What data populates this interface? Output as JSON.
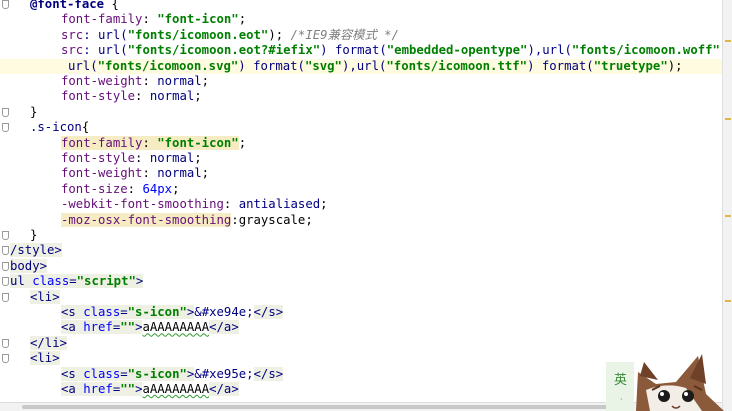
{
  "lines": [
    {
      "segs": [
        {
          "t": "@font-face",
          "c": "tok-kw"
        },
        {
          "t": " {",
          "c": "tok-punct"
        }
      ],
      "indent": 30,
      "fold": true
    },
    {
      "segs": [
        {
          "t": "font-family",
          "c": "tok-prop"
        },
        {
          "t": ": ",
          "c": "tok-punct"
        },
        {
          "t": "\"font-icon\"",
          "c": "tok-str"
        },
        {
          "t": ";",
          "c": "tok-punct"
        }
      ],
      "indent": 61
    },
    {
      "segs": [
        {
          "t": "src",
          "c": "tok-prop"
        },
        {
          "t": ": url(",
          "c": "tok-val"
        },
        {
          "t": "\"fonts/icomoon.eot\"",
          "c": "tok-str"
        },
        {
          "t": "); ",
          "c": "tok-punct"
        },
        {
          "t": "/*IE9兼容模式 */",
          "c": "tok-comment"
        }
      ],
      "indent": 61
    },
    {
      "segs": [
        {
          "t": "src",
          "c": "tok-prop"
        },
        {
          "t": ": url(",
          "c": "tok-val"
        },
        {
          "t": "\"fonts/icomoon.eot?#iefix\"",
          "c": "tok-str"
        },
        {
          "t": ") format(",
          "c": "tok-val"
        },
        {
          "t": "\"embedded-opentype\"",
          "c": "tok-str"
        },
        {
          "t": "),url(",
          "c": "tok-val"
        },
        {
          "t": "\"fonts/icomoon.woff\"",
          "c": "tok-str"
        },
        {
          "t": ")",
          "c": "tok-punct"
        }
      ],
      "indent": 61
    },
    {
      "segs": [
        {
          "t": "url(",
          "c": "tok-val"
        },
        {
          "t": "\"fonts/icomoon.svg\"",
          "c": "tok-str"
        },
        {
          "t": ") format(",
          "c": "tok-val"
        },
        {
          "t": "\"svg\"",
          "c": "tok-str"
        },
        {
          "t": "),url(",
          "c": "tok-val"
        },
        {
          "t": "\"fonts/icomoon.ttf\"",
          "c": "tok-str"
        },
        {
          "t": ") format(",
          "c": "tok-val"
        },
        {
          "t": "\"truetype\"",
          "c": "tok-str"
        },
        {
          "t": ");",
          "c": "tok-punct"
        }
      ],
      "indent": 68,
      "current": true
    },
    {
      "segs": [
        {
          "t": "font-weight",
          "c": "tok-prop"
        },
        {
          "t": ": ",
          "c": "tok-punct"
        },
        {
          "t": "normal",
          "c": "tok-val"
        },
        {
          "t": ";",
          "c": "tok-punct"
        }
      ],
      "indent": 61
    },
    {
      "segs": [
        {
          "t": "font-style",
          "c": "tok-prop"
        },
        {
          "t": ": ",
          "c": "tok-punct"
        },
        {
          "t": "normal",
          "c": "tok-val"
        },
        {
          "t": ";",
          "c": "tok-punct"
        }
      ],
      "indent": 61
    },
    {
      "segs": [
        {
          "t": "}",
          "c": "tok-punct"
        }
      ],
      "indent": 30,
      "fold": true
    },
    {
      "segs": [
        {
          "t": ".s-icon",
          "c": "tok-cls"
        },
        {
          "t": "{",
          "c": "tok-punct"
        }
      ],
      "indent": 30,
      "fold": true
    },
    {
      "segs": [
        {
          "t": "font-family",
          "c": "tok-prop hl"
        },
        {
          "t": ": ",
          "c": "tok-punct hl"
        },
        {
          "t": "\"font-icon\"",
          "c": "tok-str hl"
        },
        {
          "t": ";",
          "c": "tok-punct"
        }
      ],
      "indent": 61
    },
    {
      "segs": [
        {
          "t": "font-style",
          "c": "tok-prop"
        },
        {
          "t": ": ",
          "c": "tok-punct"
        },
        {
          "t": "normal",
          "c": "tok-val"
        },
        {
          "t": ";",
          "c": "tok-punct"
        }
      ],
      "indent": 61
    },
    {
      "segs": [
        {
          "t": "font-weight",
          "c": "tok-prop"
        },
        {
          "t": ": ",
          "c": "tok-punct"
        },
        {
          "t": "normal",
          "c": "tok-val"
        },
        {
          "t": ";",
          "c": "tok-punct"
        }
      ],
      "indent": 61
    },
    {
      "segs": [
        {
          "t": "font-size",
          "c": "tok-prop"
        },
        {
          "t": ": ",
          "c": "tok-punct"
        },
        {
          "t": "64px",
          "c": "tok-num"
        },
        {
          "t": ";",
          "c": "tok-punct"
        }
      ],
      "indent": 61
    },
    {
      "segs": [
        {
          "t": "-webkit-font-smoothing",
          "c": "tok-prop"
        },
        {
          "t": ": ",
          "c": "tok-punct"
        },
        {
          "t": "antialiased",
          "c": "tok-val"
        },
        {
          "t": ";",
          "c": "tok-punct"
        }
      ],
      "indent": 61
    },
    {
      "segs": [
        {
          "t": "-moz-osx-font-smoothing",
          "c": "tok-prop hl"
        },
        {
          "t": ":",
          "c": "tok-punct"
        },
        {
          "t": "grayscale",
          "c": "tok-text"
        },
        {
          "t": ";",
          "c": "tok-punct"
        }
      ],
      "indent": 61
    },
    {
      "segs": [
        {
          "t": "}",
          "c": "tok-punct"
        }
      ],
      "indent": 30,
      "fold": true
    },
    {
      "segs": [
        {
          "t": "/style",
          "c": "tok-tag tagbox"
        },
        {
          "t": ">",
          "c": "tok-tag tagbox"
        }
      ],
      "indent": 10,
      "fold": true
    },
    {
      "segs": [
        {
          "t": "body",
          "c": "tok-tag tagbox"
        },
        {
          "t": ">",
          "c": "tok-tag tagbox"
        }
      ],
      "indent": 10,
      "fold": true
    },
    {
      "segs": [
        {
          "t": "ul ",
          "c": "tok-tag tagbox"
        },
        {
          "t": "class",
          "c": "tok-attr tagbox"
        },
        {
          "t": "=",
          "c": "tok-tag tagbox"
        },
        {
          "t": "\"script\"",
          "c": "tok-str tagbox"
        },
        {
          "t": ">",
          "c": "tok-tag tagbox"
        }
      ],
      "indent": 10,
      "fold": true
    },
    {
      "segs": [
        {
          "t": "<li>",
          "c": "tok-tag tagbox"
        }
      ],
      "indent": 30,
      "fold": true
    },
    {
      "segs": [
        {
          "t": "<s ",
          "c": "tok-tag tagbox"
        },
        {
          "t": "class",
          "c": "tok-attr tagbox"
        },
        {
          "t": "=",
          "c": "tok-tag tagbox"
        },
        {
          "t": "\"s-icon\"",
          "c": "tok-str tagbox"
        },
        {
          "t": ">",
          "c": "tok-tag tagbox"
        },
        {
          "t": "&#xe94e;",
          "c": "tok-entity"
        },
        {
          "t": "</s>",
          "c": "tok-tag tagbox"
        }
      ],
      "indent": 61
    },
    {
      "segs": [
        {
          "t": "<a ",
          "c": "tok-tag tagbox"
        },
        {
          "t": "href",
          "c": "tok-attr tagbox"
        },
        {
          "t": "=",
          "c": "tok-tag tagbox"
        },
        {
          "t": "\"\"",
          "c": "tok-str tagbox"
        },
        {
          "t": ">",
          "c": "tok-tag tagbox"
        },
        {
          "t": "aAAAAAAAA",
          "c": "tok-text squiggle"
        },
        {
          "t": "</a>",
          "c": "tok-tag tagbox"
        }
      ],
      "indent": 61
    },
    {
      "segs": [
        {
          "t": "</li>",
          "c": "tok-tag tagbox"
        }
      ],
      "indent": 30,
      "fold": true
    },
    {
      "segs": [
        {
          "t": "<li>",
          "c": "tok-tag tagbox"
        }
      ],
      "indent": 30,
      "fold": true
    },
    {
      "segs": [
        {
          "t": "<s ",
          "c": "tok-tag tagbox"
        },
        {
          "t": "class",
          "c": "tok-attr tagbox"
        },
        {
          "t": "=",
          "c": "tok-tag tagbox"
        },
        {
          "t": "\"s-icon\"",
          "c": "tok-str tagbox"
        },
        {
          "t": ">",
          "c": "tok-tag tagbox"
        },
        {
          "t": "&#xe95e;",
          "c": "tok-entity"
        },
        {
          "t": "</s>",
          "c": "tok-tag tagbox"
        }
      ],
      "indent": 61
    },
    {
      "segs": [
        {
          "t": "<a ",
          "c": "tok-tag tagbox"
        },
        {
          "t": "href",
          "c": "tok-attr tagbox"
        },
        {
          "t": "=",
          "c": "tok-tag tagbox"
        },
        {
          "t": "\"\"",
          "c": "tok-str tagbox"
        },
        {
          "t": ">",
          "c": "tok-tag tagbox"
        },
        {
          "t": "aAAAAAAAA",
          "c": "tok-text squiggle"
        },
        {
          "t": "</a>",
          "c": "tok-tag tagbox"
        }
      ],
      "indent": 61
    }
  ],
  "ime_label": "英",
  "colors": {
    "current_line": "#fffbe0",
    "highlight": "#f5ecc3"
  }
}
